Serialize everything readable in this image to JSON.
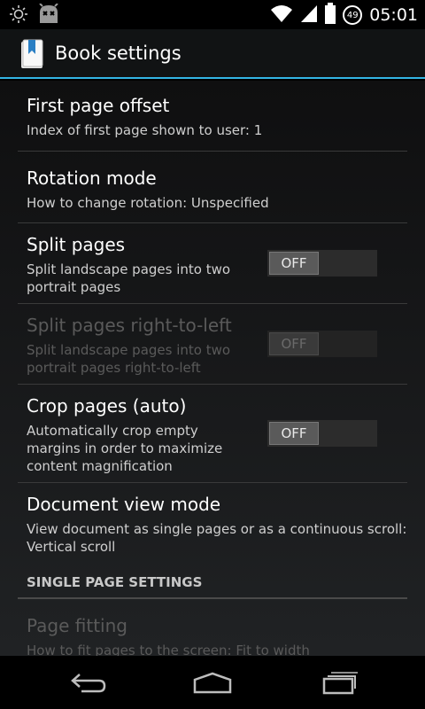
{
  "status_bar": {
    "time": "05:01",
    "notification_badge": "49",
    "icons": [
      "brightness-icon",
      "android-robot-icon",
      "wifi-icon",
      "signal-icon",
      "battery-icon"
    ]
  },
  "action_bar": {
    "title": "Book settings",
    "accent_color": "#33b5e5"
  },
  "preferences": [
    {
      "title": "First page offset",
      "summary": "Index of first page shown to user: 1"
    },
    {
      "title": "Rotation mode",
      "summary": "How to change rotation: Unspecified"
    },
    {
      "title": "Split pages",
      "summary": "Split landscape pages into two portrait pages",
      "toggle": "OFF"
    },
    {
      "title": "Split pages right-to-left",
      "summary": "Split landscape pages into two portrait pages right-to-left",
      "toggle": "OFF",
      "enabled": false
    },
    {
      "title": "Crop pages (auto)",
      "summary": "Automatically crop empty margins in order to maximize content magnification",
      "toggle": "OFF"
    },
    {
      "title": "Document view mode",
      "summary": "View document as single pages or as a continuous scroll: Vertical scroll"
    }
  ],
  "section": {
    "header": "SINGLE PAGE SETTINGS"
  },
  "single_page_preferences": [
    {
      "title": "Page fitting",
      "summary": "How to fit pages to the screen: Fit to width",
      "enabled": false
    }
  ],
  "nav_bar": {
    "icons": [
      "back-icon",
      "home-icon",
      "recent-apps-icon"
    ]
  }
}
